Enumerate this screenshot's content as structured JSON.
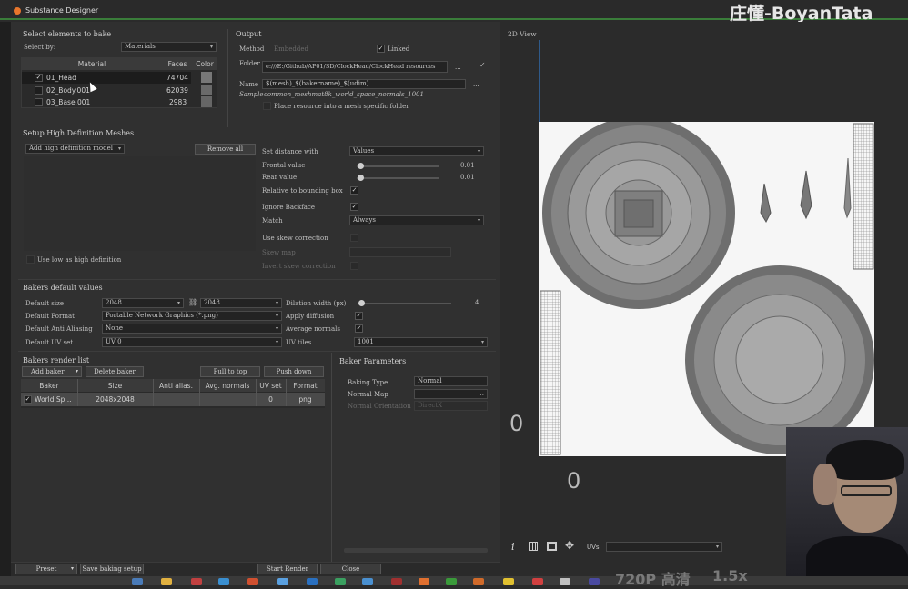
{
  "window": {
    "title": "Substance Designer",
    "watermark": "庄懂-BoyanTata"
  },
  "select": {
    "header": "Select elements to bake",
    "select_by_label": "Select by:",
    "select_by_value": "Materials",
    "columns": [
      "Material",
      "Faces",
      "Color"
    ],
    "rows": [
      {
        "name": "01_Head",
        "faces": "74704",
        "checked": true
      },
      {
        "name": "02_Body.001",
        "faces": "62039",
        "checked": false
      },
      {
        "name": "03_Base.001",
        "faces": "2983",
        "checked": false
      }
    ]
  },
  "output": {
    "header": "Output",
    "method_label": "Method",
    "method_value": "Embedded",
    "linked_label": "Linked",
    "folder_label": "Folder",
    "folder_value": "e:///E:/Github/AP01/SD/ClockHead/ClockHead resources",
    "folder_more": "...",
    "name_label": "Name",
    "name_value": "$(mesh)_$(bakername)_$(udim)",
    "sample_label": "Sample",
    "sample_value": "common_meshmat8k_world_space_normals_1001",
    "place_label": "Place resource into a mesh specific folder",
    "name_more": "..."
  },
  "hd": {
    "header": "Setup High Definition Meshes",
    "add_label": "Add high definition model",
    "remove_label": "Remove all",
    "low_as_high": "Use low as high definition",
    "set_distance_label": "Set distance with",
    "set_distance_value": "Values",
    "frontal_label": "Frontal value",
    "frontal_value": "0.01",
    "rear_label": "Rear value",
    "rear_value": "0.01",
    "relative_label": "Relative to bounding box",
    "ignore_label": "Ignore Backface",
    "match_label": "Match",
    "match_value": "Always",
    "skew_label": "Use skew correction",
    "skew_map_label": "Skew map",
    "invert_label": "Invert skew correction"
  },
  "defaults": {
    "header": "Bakers default values",
    "size_label": "Default size",
    "size_value": "2048",
    "size_value2": "2048",
    "format_label": "Default Format",
    "format_value": "Portable Network Graphics (*.png)",
    "aa_label": "Default Anti Aliasing",
    "aa_value": "None",
    "uv_label": "Default UV set",
    "uv_value": "UV 0",
    "dilation_label": "Dilation width (px)",
    "dilation_value": "4",
    "diffusion_label": "Apply diffusion",
    "avg_label": "Average normals",
    "uvtiles_label": "UV tiles",
    "uvtiles_value": "1001"
  },
  "render_list": {
    "header": "Bakers render list",
    "add_baker": "Add baker",
    "delete_baker": "Delete baker",
    "pull_top": "Pull to top",
    "push_down": "Push down",
    "columns": [
      "Baker",
      "Size",
      "Anti alias.",
      "Avg. normals",
      "UV set",
      "Format"
    ],
    "row": {
      "baker": "World Sp...",
      "size": "2048x2048",
      "aa": "",
      "avg": "",
      "uv": "0",
      "format": "png"
    }
  },
  "params": {
    "header": "Baker Parameters",
    "baking_type_label": "Baking Type",
    "baking_type_value": "Normal",
    "normal_map_label": "Normal Map",
    "normal_orient_label": "Normal Orientation",
    "normal_orient_value": "DirectX"
  },
  "view2d": {
    "title": "2D View",
    "uvs_label": "UVs",
    "zero_label": "0"
  },
  "footer": {
    "preset": "Preset",
    "save": "Save baking setup",
    "start": "Start Render",
    "close": "Close"
  },
  "taskbar": {
    "quality": "720P 高清",
    "speed": "1.5x"
  }
}
